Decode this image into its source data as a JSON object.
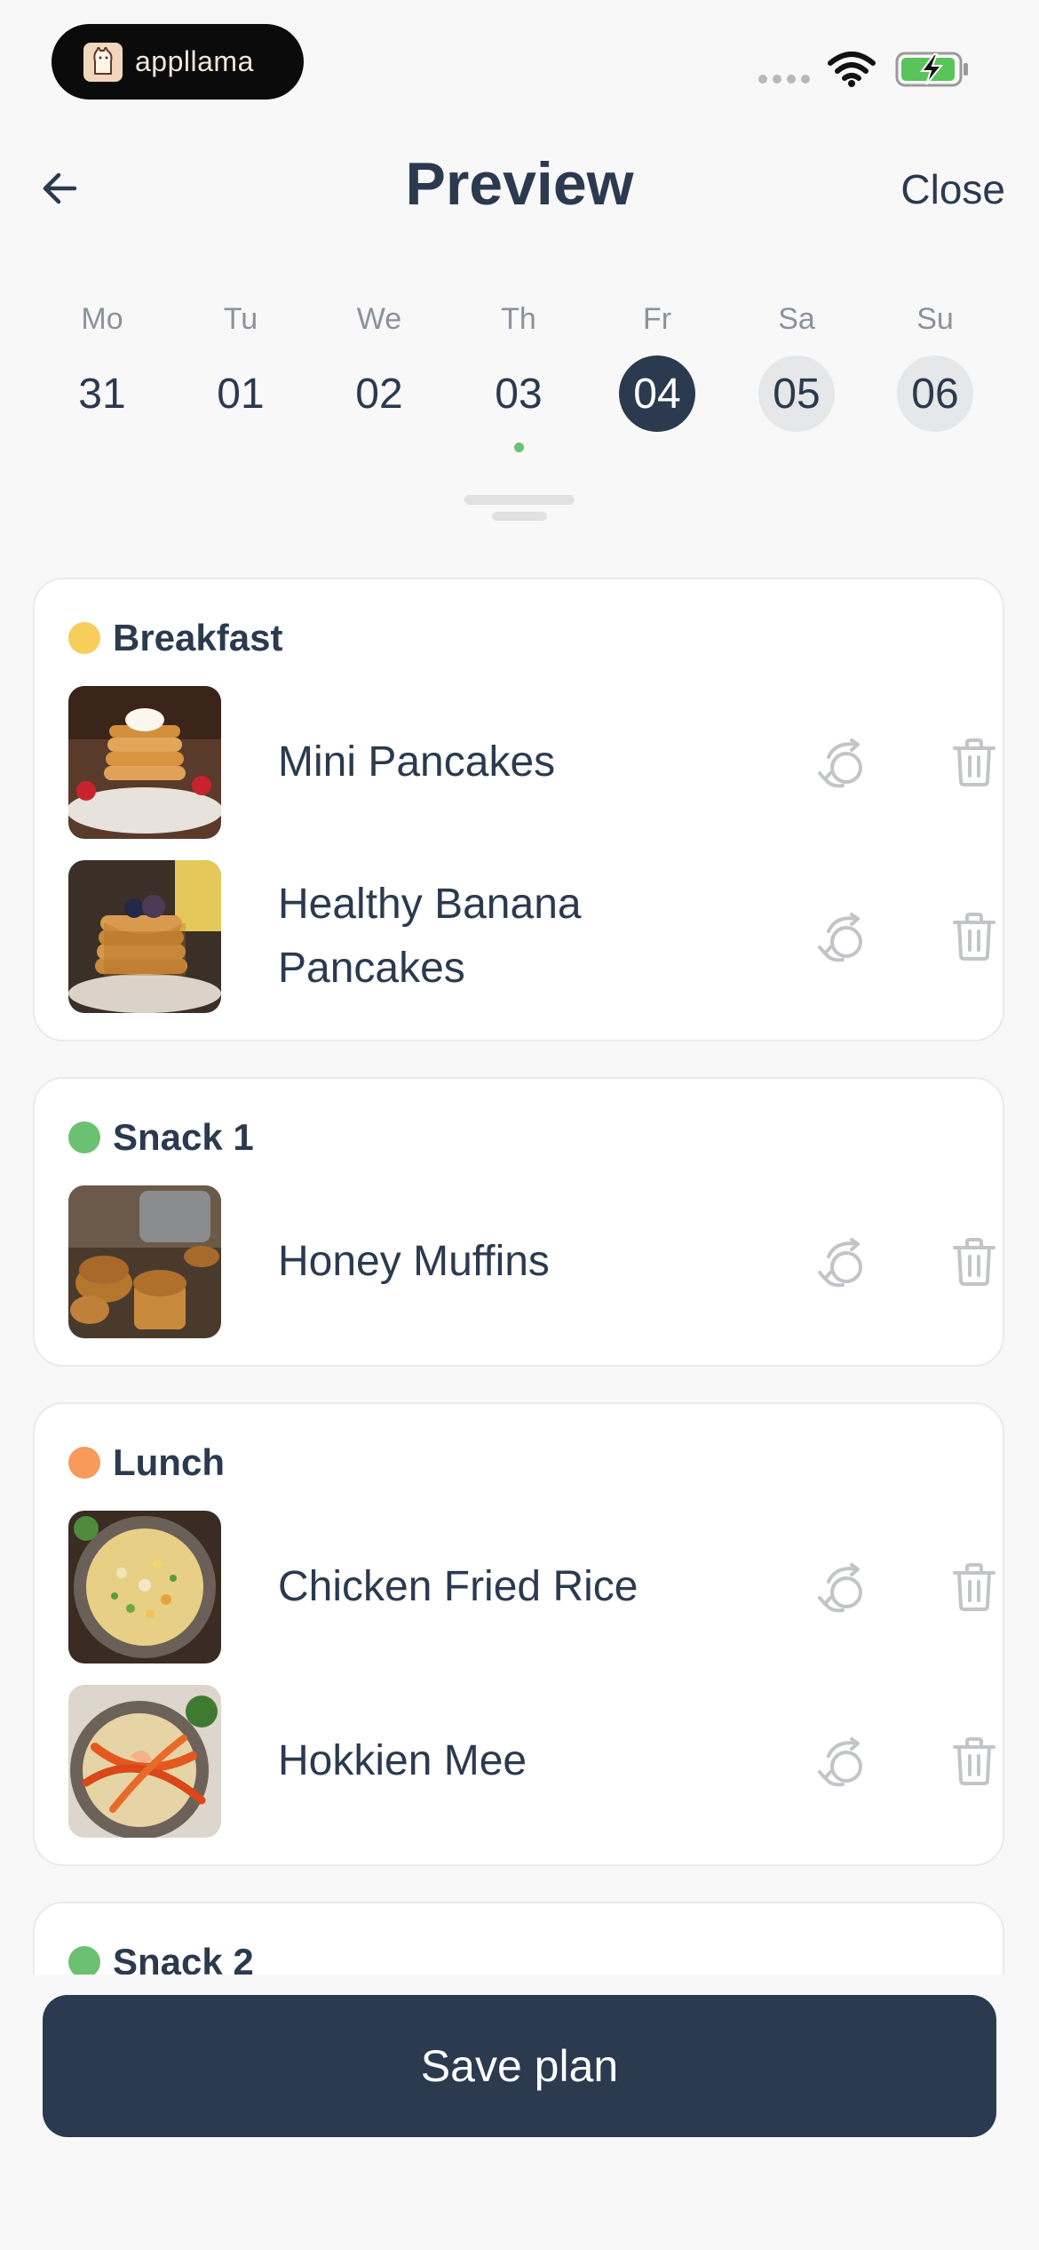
{
  "status_bar": {
    "app_badge": "appllama"
  },
  "header": {
    "title": "Preview",
    "close_label": "Close"
  },
  "days": [
    {
      "dn": "Mo",
      "num": "31",
      "state": "normal",
      "dot": false
    },
    {
      "dn": "Tu",
      "num": "01",
      "state": "normal",
      "dot": false
    },
    {
      "dn": "We",
      "num": "02",
      "state": "normal",
      "dot": false
    },
    {
      "dn": "Th",
      "num": "03",
      "state": "normal",
      "dot": true
    },
    {
      "dn": "Fr",
      "num": "04",
      "state": "selected",
      "dot": false
    },
    {
      "dn": "Sa",
      "num": "05",
      "state": "grey",
      "dot": false
    },
    {
      "dn": "Su",
      "num": "06",
      "state": "grey",
      "dot": false
    }
  ],
  "meals": [
    {
      "title": "Breakfast",
      "color": "#f7cd5c",
      "items": [
        {
          "name": "Mini Pancakes"
        },
        {
          "name": "Healthy Banana Pancakes"
        }
      ]
    },
    {
      "title": "Snack 1",
      "color": "#6cc072",
      "items": [
        {
          "name": "Honey Muffins"
        }
      ]
    },
    {
      "title": "Lunch",
      "color": "#f79a5a",
      "items": [
        {
          "name": "Chicken Fried Rice"
        },
        {
          "name": "Hokkien Mee"
        }
      ]
    },
    {
      "title": "Snack 2",
      "color": "#6cc072",
      "items": []
    }
  ],
  "save_label": "Save plan",
  "colors": {
    "primary": "#2b3a4e",
    "selected_day": "#2b3a4e",
    "dot_green": "#6cc072"
  }
}
